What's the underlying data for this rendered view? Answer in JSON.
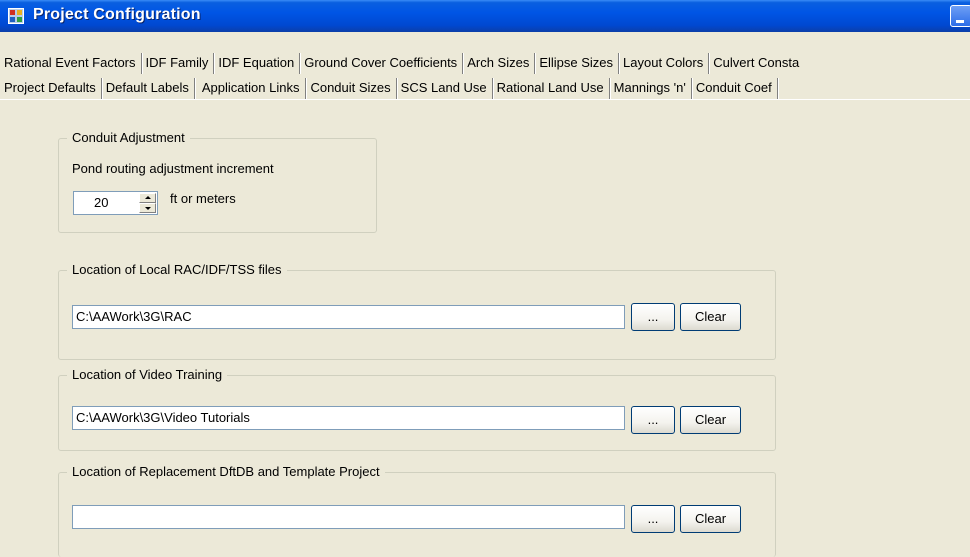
{
  "window": {
    "title": "Project Configuration"
  },
  "tabs_row1": [
    "Rational Event Factors",
    "IDF Family",
    "IDF Equation",
    "Ground Cover Coefficients",
    "Arch Sizes",
    "Ellipse Sizes",
    "Layout Colors",
    "Culvert Consta"
  ],
  "tabs_row2": [
    "Project Defaults",
    "Default Labels",
    "Application Links",
    "Conduit Sizes",
    "SCS Land Use",
    "Rational Land Use",
    "Mannings 'n'",
    "Conduit Coef"
  ],
  "active_tab": "Application Links",
  "conduit_adjustment": {
    "legend": "Conduit Adjustment",
    "label": "Pond routing adjustment increment",
    "value": "20",
    "unit": "ft or meters"
  },
  "rac_location": {
    "legend": "Location of Local RAC/IDF/TSS files",
    "path": "C:\\AAWork\\3G\\RAC"
  },
  "video_location": {
    "legend": "Location of Video Training",
    "path": "C:\\AAWork\\3G\\Video Tutorials"
  },
  "replacement_location": {
    "legend": "Location of Replacement DftDB and Template Project",
    "path": ""
  },
  "buttons": {
    "browse": "...",
    "clear": "Clear"
  }
}
